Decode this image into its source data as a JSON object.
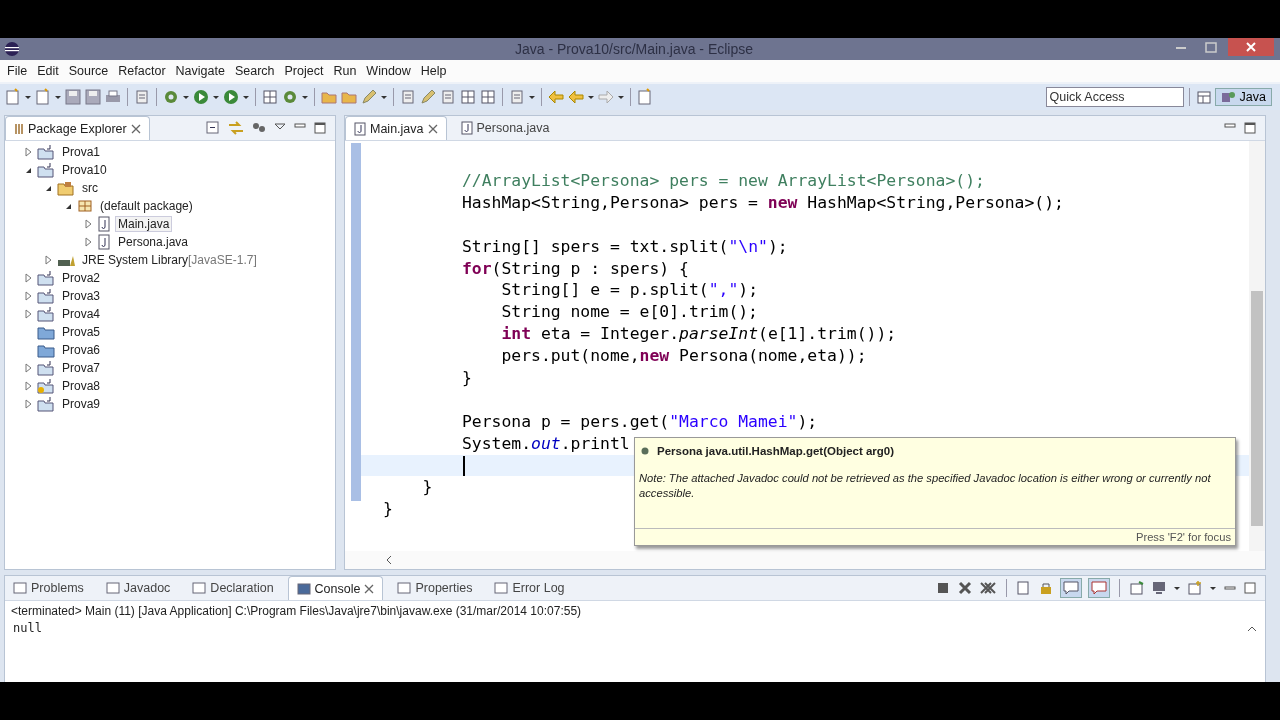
{
  "window": {
    "title": "Java - Prova10/src/Main.java - Eclipse"
  },
  "menu": [
    "File",
    "Edit",
    "Source",
    "Refactor",
    "Navigate",
    "Search",
    "Project",
    "Run",
    "Window",
    "Help"
  ],
  "quick_access": {
    "placeholder": "Quick Access"
  },
  "perspective": {
    "label": "Java",
    "selected": true
  },
  "package_explorer": {
    "title": "Package Explorer",
    "items": [
      {
        "label": "Prova1",
        "kind": "project",
        "expanded": false,
        "selected": false
      },
      {
        "label": "Prova10",
        "kind": "project",
        "expanded": true,
        "selected": false,
        "children": [
          {
            "label": "src",
            "kind": "folder",
            "expanded": true,
            "selected": false,
            "children": [
              {
                "label": "(default package)",
                "kind": "package",
                "expanded": true,
                "selected": false,
                "children": [
                  {
                    "label": "Main.java",
                    "kind": "file",
                    "expanded": false,
                    "selected": true
                  },
                  {
                    "label": "Persona.java",
                    "kind": "file",
                    "expanded": false,
                    "selected": false
                  }
                ]
              }
            ]
          },
          {
            "label": "JRE System Library",
            "extra": "[JavaSE-1.7]",
            "kind": "library",
            "expanded": false,
            "selected": false
          }
        ]
      },
      {
        "label": "Prova2",
        "kind": "project",
        "expanded": false,
        "selected": false
      },
      {
        "label": "Prova3",
        "kind": "project",
        "expanded": false,
        "selected": false
      },
      {
        "label": "Prova4",
        "kind": "project",
        "expanded": false,
        "selected": false
      },
      {
        "label": "Prova5",
        "kind": "closed",
        "selected": false
      },
      {
        "label": "Prova6",
        "kind": "closed",
        "selected": false
      },
      {
        "label": "Prova7",
        "kind": "project",
        "expanded": false,
        "selected": false
      },
      {
        "label": "Prova8",
        "kind": "warning",
        "expanded": false,
        "selected": false
      },
      {
        "label": "Prova9",
        "kind": "project",
        "expanded": false,
        "selected": false
      }
    ]
  },
  "editor": {
    "tabs": [
      {
        "label": "Main.java",
        "selected": true
      },
      {
        "label": "Persona.java",
        "selected": false
      }
    ],
    "lines": [
      {
        "current": false,
        "tokens": [
          {
            "kind": "comment",
            "text": "        //ArrayList<Persona> pers = new ArrayList<Persona>();"
          }
        ]
      },
      {
        "current": false,
        "tokens": [
          {
            "kind": "plain",
            "text": "        HashMap<String,Persona> pers = "
          },
          {
            "kind": "keyword",
            "text": "new"
          },
          {
            "kind": "plain",
            "text": " HashMap<String,Persona>();"
          }
        ]
      },
      {
        "current": false
      },
      {
        "current": false,
        "tokens": [
          {
            "kind": "plain",
            "text": "        String[] spers = txt.split("
          },
          {
            "kind": "string",
            "text": "\"\\n\""
          },
          {
            "kind": "plain",
            "text": ");"
          }
        ]
      },
      {
        "current": false,
        "tokens": [
          {
            "kind": "keyword",
            "text": "        for"
          },
          {
            "kind": "plain",
            "text": "(String p : spers) {"
          }
        ]
      },
      {
        "current": false,
        "tokens": [
          {
            "kind": "plain",
            "text": "            String[] e = p.split("
          },
          {
            "kind": "string",
            "text": "\",\""
          },
          {
            "kind": "plain",
            "text": ");"
          }
        ]
      },
      {
        "current": false,
        "tokens": [
          {
            "kind": "plain",
            "text": "            String nome = e[0].trim();"
          }
        ]
      },
      {
        "current": false,
        "tokens": [
          {
            "kind": "keyword",
            "text": "            int"
          },
          {
            "kind": "plain",
            "text": " eta = Integer."
          },
          {
            "kind": "italic",
            "text": "parseInt"
          },
          {
            "kind": "plain",
            "text": "(e[1].trim());"
          }
        ]
      },
      {
        "current": false,
        "tokens": [
          {
            "kind": "plain",
            "text": "            pers.put(nome,"
          },
          {
            "kind": "keyword",
            "text": "new"
          },
          {
            "kind": "plain",
            "text": " Persona(nome,eta));"
          }
        ]
      },
      {
        "current": false,
        "tokens": [
          {
            "kind": "plain",
            "text": "        }"
          }
        ]
      },
      {
        "current": false
      },
      {
        "current": false,
        "tokens": [
          {
            "kind": "plain",
            "text": "        Persona p = pers.get("
          },
          {
            "kind": "string",
            "text": "\"Marco Mamei\""
          },
          {
            "kind": "plain",
            "text": ");"
          }
        ]
      },
      {
        "current": false,
        "tokens": [
          {
            "kind": "plain",
            "text": "        System."
          },
          {
            "kind": "field",
            "text": "out"
          },
          {
            "kind": "plain",
            "text": ".printl"
          }
        ]
      },
      {
        "current": true
      },
      {
        "current": false,
        "tokens": [
          {
            "kind": "plain",
            "text": "    }"
          }
        ]
      },
      {
        "current": false,
        "tokens": [
          {
            "kind": "plain",
            "text": "}"
          }
        ]
      }
    ]
  },
  "hover": {
    "signature": "Persona java.util.HashMap.get(Object arg0)",
    "note": "Note: The attached Javadoc could not be retrieved as the specified Javadoc location is either wrong or currently not accessible.",
    "footer": "Press 'F2' for focus"
  },
  "bottom_panel": {
    "tabs": [
      {
        "label": "Problems",
        "selected": false
      },
      {
        "label": "Javadoc",
        "selected": false
      },
      {
        "label": "Declaration",
        "selected": false
      },
      {
        "label": "Console",
        "selected": true
      },
      {
        "label": "Properties",
        "selected": false
      },
      {
        "label": "Error Log",
        "selected": false
      }
    ],
    "status": "<terminated> Main (11) [Java Application] C:\\Program Files\\Java\\jre7\\bin\\javaw.exe (31/mar/2014 10:07:55)",
    "output": "null"
  }
}
